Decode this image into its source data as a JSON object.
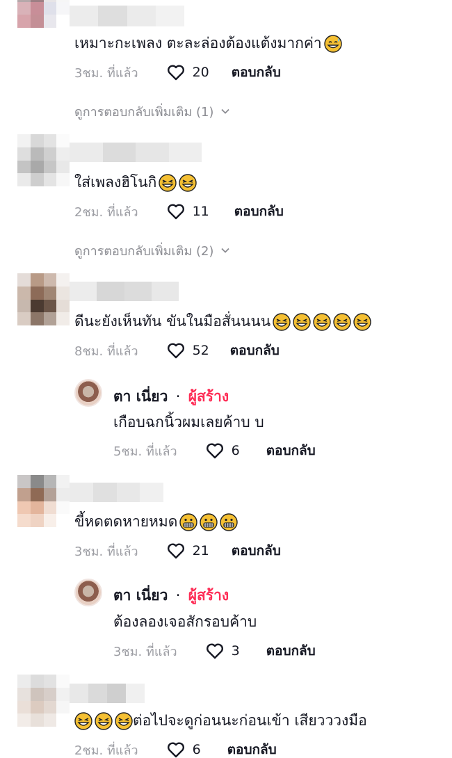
{
  "comments": [
    {
      "text": "เหมาะกะเพลง ตะละล่องต้องแต้งมากค่า",
      "emoji_count": 1,
      "emoji": "sweat-smile-emoji",
      "time": "3ชม. ที่แล้ว",
      "likes": "20",
      "reply_label": "ตอบกลับ",
      "view_more": "ดูการตอบกลับเพิ่มเติม (1)"
    },
    {
      "text": "ใส่เพลงฮิโนกิ",
      "emoji_count": 2,
      "emoji": "laughing-emoji",
      "time": "2ชม. ที่แล้ว",
      "likes": "11",
      "reply_label": "ตอบกลับ",
      "view_more": "ดูการตอบกลับเพิ่มเติม (2)"
    },
    {
      "text": "ดีนะยังเห็นทัน ขันในมือสั่นนนน",
      "emoji_count": 5,
      "emoji": "laughing-emoji",
      "time": "8ชม. ที่แล้ว",
      "likes": "52",
      "reply_label": "ตอบกลับ",
      "reply": {
        "name": "ตา เนี่ยว",
        "separator": "·",
        "badge": "ผู้สร้าง",
        "text": "เกือบฉกนิ้วผมเลยค้าบ บ",
        "time": "5ชม. ที่แล้ว",
        "likes": "6",
        "reply_label": "ตอบกลับ"
      }
    },
    {
      "text": "ขี้หดตดหายหมด",
      "emoji_count": 3,
      "emoji": "grinning-emoji",
      "time": "3ชม. ที่แล้ว",
      "likes": "21",
      "reply_label": "ตอบกลับ",
      "reply": {
        "name": "ตา เนี่ยว",
        "separator": "·",
        "badge": "ผู้สร้าง",
        "text": "ต้องลองเจอสักรอบค้าบ",
        "time": "3ชม. ที่แล้ว",
        "likes": "3",
        "reply_label": "ตอบกลับ"
      }
    },
    {
      "text": "ต่อไปจะดูก่อนนะก่อนเข้า เสียวววงมือ",
      "emoji_count": 3,
      "emoji": "laughing-emoji",
      "emoji_position": "before",
      "time": "2ชม. ที่แล้ว",
      "likes": "6",
      "reply_label": "ตอบกลับ"
    }
  ],
  "colors": {
    "creator_badge": "#fe2c55",
    "muted_text": "#9d9ea4",
    "primary_text": "#161823"
  }
}
